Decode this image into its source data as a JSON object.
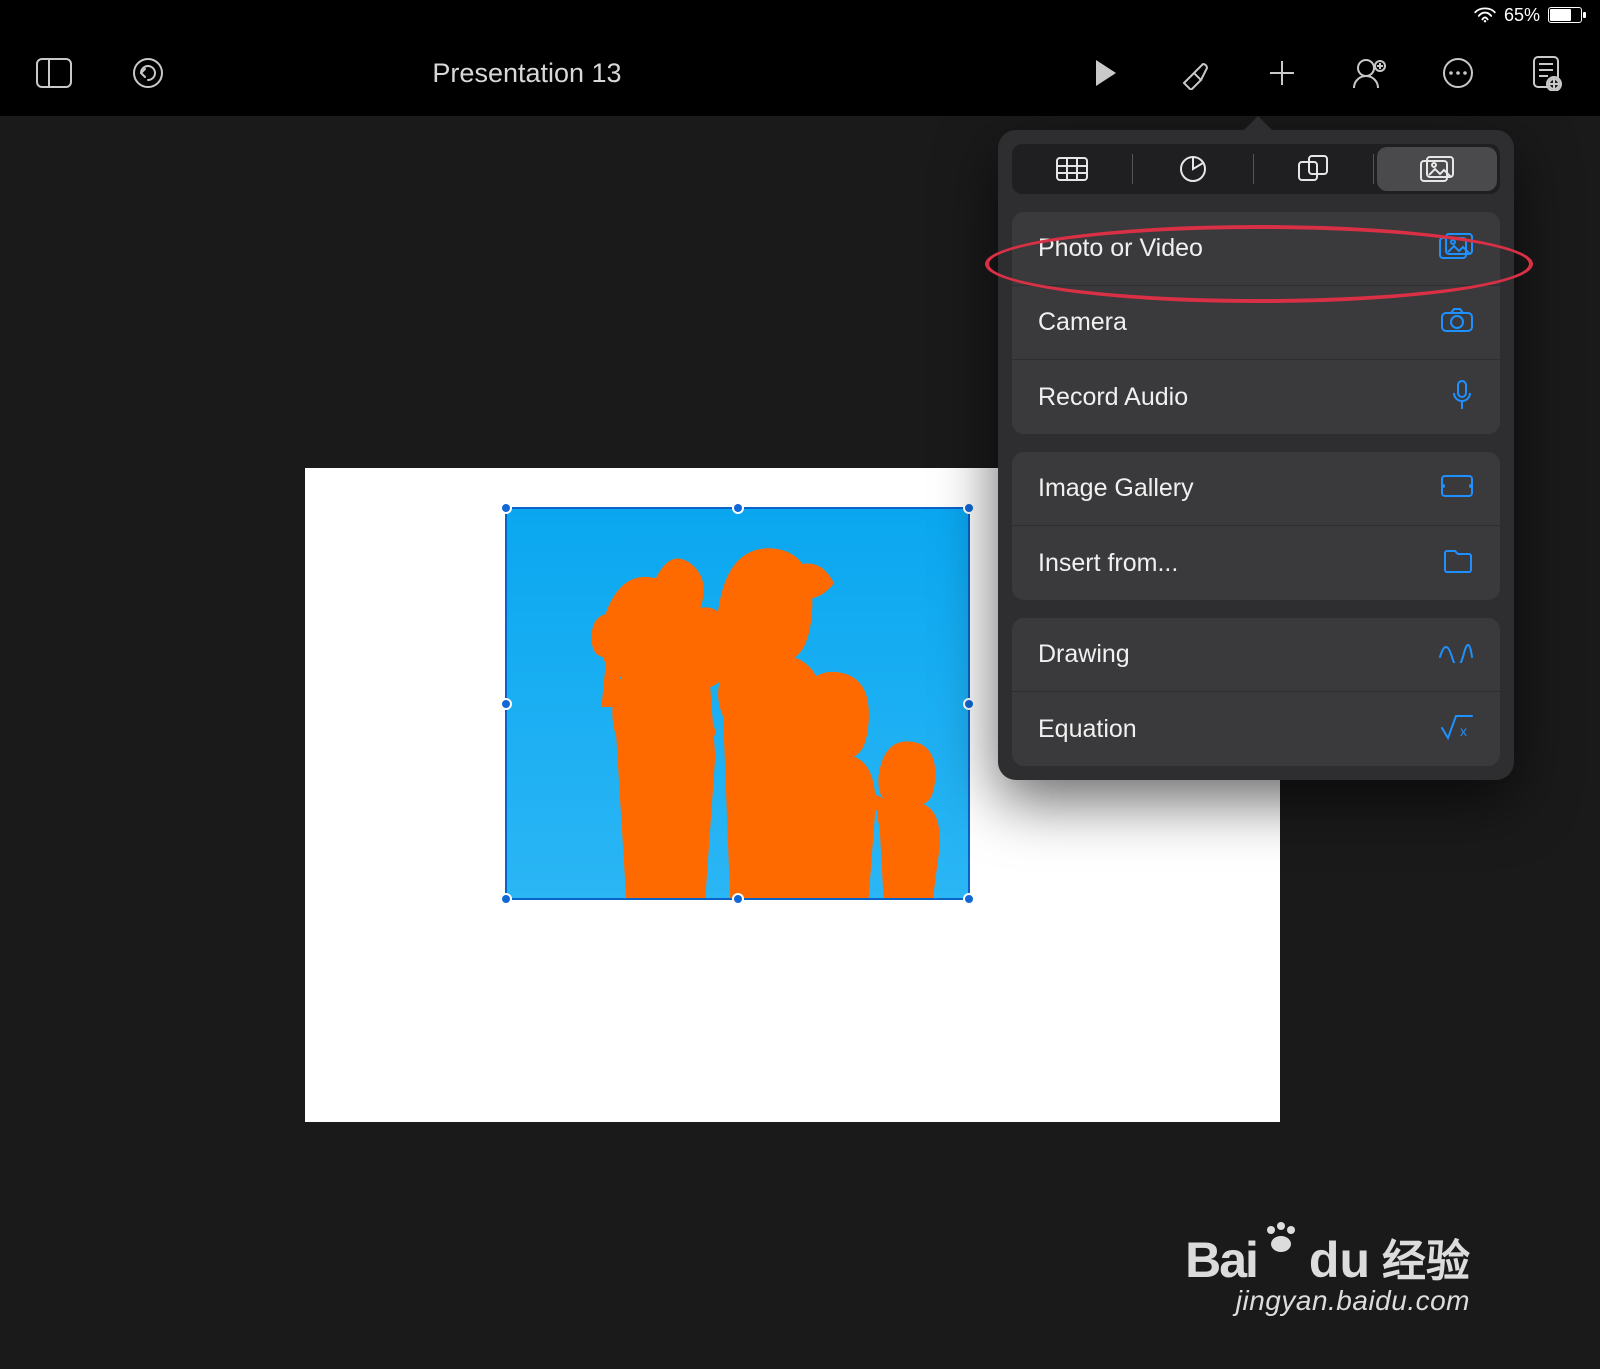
{
  "status": {
    "battery_percent": "65%"
  },
  "toolbar": {
    "title": "Presentation 13"
  },
  "insert_popover": {
    "tabs": [
      "tables",
      "charts",
      "shapes",
      "media"
    ],
    "active_tab_index": 3,
    "groups": [
      {
        "rows": [
          {
            "label": "Photo or Video",
            "icon": "photo-video"
          },
          {
            "label": "Camera",
            "icon": "camera"
          },
          {
            "label": "Record Audio",
            "icon": "mic"
          }
        ]
      },
      {
        "rows": [
          {
            "label": "Image Gallery",
            "icon": "gallery"
          },
          {
            "label": "Insert from...",
            "icon": "folder"
          }
        ]
      },
      {
        "rows": [
          {
            "label": "Drawing",
            "icon": "scribble"
          },
          {
            "label": "Equation",
            "icon": "equation"
          }
        ]
      }
    ]
  },
  "watermark": {
    "brand_left": "Bai",
    "brand_right": "du",
    "brand_cn": "经验",
    "sub": "jingyan.baidu.com"
  },
  "accent_color": "#1e90ff"
}
